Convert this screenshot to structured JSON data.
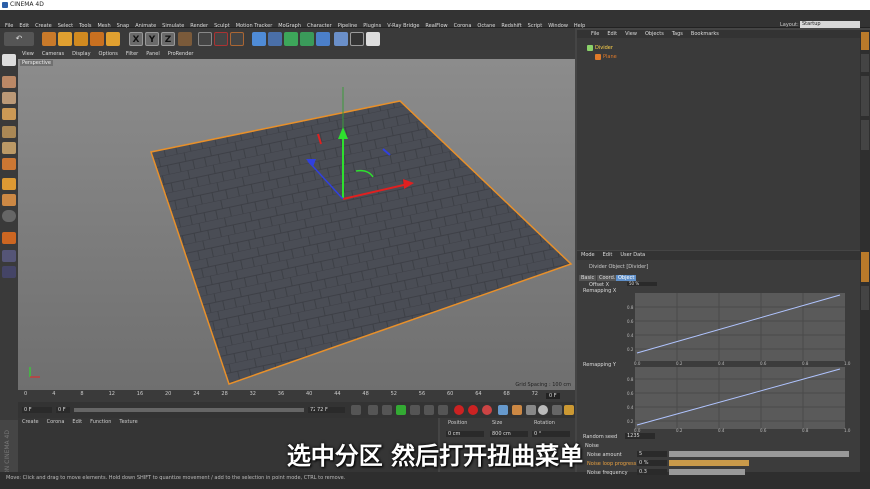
{
  "app": {
    "title": "CINEMA 4D"
  },
  "menu": [
    "File",
    "Edit",
    "Create",
    "Select",
    "Tools",
    "Mesh",
    "Snap",
    "Animate",
    "Simulate",
    "Render",
    "Sculpt",
    "Motion Tracker",
    "MoGraph",
    "Character",
    "Pipeline",
    "Plugins",
    "V-Ray Bridge",
    "RealFlow",
    "Corona",
    "Octane",
    "Redshift",
    "Script",
    "Window",
    "Help"
  ],
  "layout": {
    "label": "Layout:",
    "value": "Startup"
  },
  "toolbar": {
    "undo": "↶",
    "x": "X",
    "y": "Y",
    "z": "Z"
  },
  "viewport": {
    "menu": [
      "View",
      "Cameras",
      "Display",
      "Options",
      "Filter",
      "Panel",
      "ProRender"
    ],
    "label": "Perspective",
    "grid_spacing": "Grid Spacing : 100 cm"
  },
  "timeline": {
    "ticks": [
      "0",
      "4",
      "8",
      "12",
      "16",
      "20",
      "24",
      "28",
      "32",
      "36",
      "40",
      "44",
      "48",
      "52",
      "56",
      "60",
      "64",
      "68",
      "72"
    ],
    "end_frame": "0 F"
  },
  "transport": {
    "start": "0 F",
    "current": "0 F",
    "end": "72 F",
    "end2": "72 F"
  },
  "material_manager": {
    "menu": [
      "Create",
      "Corona",
      "Edit",
      "Function",
      "Texture"
    ]
  },
  "coord_manager": {
    "headers": [
      "Position",
      "Size",
      "Rotation"
    ],
    "row": {
      "pos": "0 cm",
      "size": "800 cm",
      "rot": "0 °"
    }
  },
  "object_manager": {
    "menu": [
      "File",
      "Edit",
      "View",
      "Objects",
      "Tags",
      "Bookmarks"
    ],
    "objects": [
      {
        "name": "Divider",
        "color": "#8bd36a"
      },
      {
        "name": "Plane",
        "color": "#e07a2a"
      }
    ]
  },
  "attribute_manager": {
    "menu": [
      "Mode",
      "Edit",
      "User Data"
    ],
    "title": "Divider Object [Divider]",
    "tabs": [
      "Basic",
      "Coord.",
      "Object"
    ],
    "active_tab": "Object",
    "remap_x": "Remapping X",
    "remap_y": "Remapping Y",
    "graph_x_ticks": [
      "0.0",
      "0.2",
      "0.4",
      "0.6",
      "0.8",
      "1.0"
    ],
    "graph_y_ticks": [
      "0.8",
      "0.6",
      "0.4",
      "0.2"
    ],
    "random_seed_label": "Random seed",
    "random_seed_value": "1235",
    "noise_label": "Noise",
    "noise_amount_label": "Noise amount",
    "noise_amount_value": "5",
    "noise_loop_label": "Noise loop progress",
    "noise_loop_value": "0 %",
    "noise_freq_label": "Noise frequency",
    "noise_freq_value": "0.3",
    "partial_row": "Offset X",
    "partial_value": "50 %"
  },
  "status": {
    "text": "Move: Click and drag to move elements. Hold down SHIFT to quantize movement / add to the selection in point mode, CTRL to remove."
  },
  "subtitle": {
    "text": "选中分区 然后打开扭曲菜单"
  },
  "maxon": "MAXON CINEMA 4D"
}
